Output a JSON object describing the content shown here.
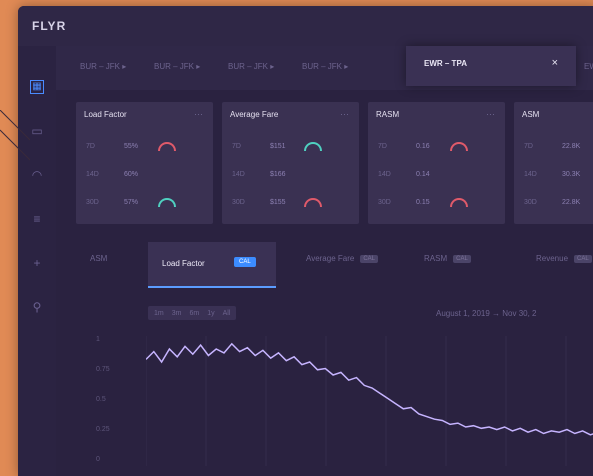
{
  "app": {
    "brand": "FLYR"
  },
  "routes": {
    "items": [
      "BUR – JFK ▸",
      "BUR – JFK ▸",
      "BUR – JFK ▸",
      "BUR – JFK ▸"
    ],
    "active": "EWR – TPA",
    "active_close": "×",
    "trailing": "EWR"
  },
  "cards": [
    {
      "title": "Load Factor",
      "rows": [
        {
          "k": "7D",
          "v": "55%",
          "gauge": "#e05a6a"
        },
        {
          "k": "14D",
          "v": "60%",
          "gauge": "none"
        },
        {
          "k": "30D",
          "v": "57%",
          "gauge": "#4fd0c0"
        }
      ]
    },
    {
      "title": "Average Fare",
      "rows": [
        {
          "k": "7D",
          "v": "$151",
          "gauge": "#4fd0c0"
        },
        {
          "k": "14D",
          "v": "$166",
          "gauge": "none"
        },
        {
          "k": "30D",
          "v": "$155",
          "gauge": "#e05a6a"
        }
      ]
    },
    {
      "title": "RASM",
      "rows": [
        {
          "k": "7D",
          "v": "0.16",
          "gauge": "#e05a6a"
        },
        {
          "k": "14D",
          "v": "0.14",
          "gauge": "none"
        },
        {
          "k": "30D",
          "v": "0.15",
          "gauge": "#e05a6a"
        }
      ]
    },
    {
      "title": "ASM",
      "rows": [
        {
          "k": "7D",
          "v": "22.8K",
          "gauge": "none"
        },
        {
          "k": "14D",
          "v": "30.3K",
          "gauge": "none"
        },
        {
          "k": "30D",
          "v": "22.8K",
          "gauge": "none"
        }
      ]
    }
  ],
  "tabs": {
    "items": [
      {
        "label": "ASM",
        "badge": ""
      },
      {
        "label": "Average Fare",
        "badge": "CAL"
      },
      {
        "label": "RASM",
        "badge": "CAL"
      },
      {
        "label": "Revenue",
        "badge": "CAL"
      }
    ],
    "active": {
      "label": "Load Factor",
      "badge": "CAL"
    }
  },
  "chart": {
    "zoom": [
      "1m",
      "3m",
      "6m",
      "1y",
      "All"
    ],
    "date_range": "August 1, 2019 → Nov 30, 2",
    "yticks": [
      "1",
      "0.75",
      "0.5",
      "0.25",
      "0"
    ],
    "line_color": "#c6b4ff"
  },
  "chart_data": {
    "type": "line",
    "series": [
      {
        "values": [
          0.82,
          0.88,
          0.8,
          0.9,
          0.84,
          0.92,
          0.86,
          0.93,
          0.85,
          0.9,
          0.87,
          0.94,
          0.88,
          0.91,
          0.85,
          0.89,
          0.83,
          0.87,
          0.81,
          0.84,
          0.78,
          0.8,
          0.74,
          0.75,
          0.7,
          0.72,
          0.66,
          0.68,
          0.62,
          0.6,
          0.56,
          0.52,
          0.48,
          0.44,
          0.45,
          0.4,
          0.38,
          0.36,
          0.35,
          0.32,
          0.33,
          0.3,
          0.31,
          0.29,
          0.3,
          0.28,
          0.3,
          0.27,
          0.29,
          0.26,
          0.28,
          0.25,
          0.27,
          0.26,
          0.28,
          0.25,
          0.27,
          0.24,
          0.26,
          0.25
        ]
      }
    ],
    "ylim": [
      0,
      1
    ]
  }
}
